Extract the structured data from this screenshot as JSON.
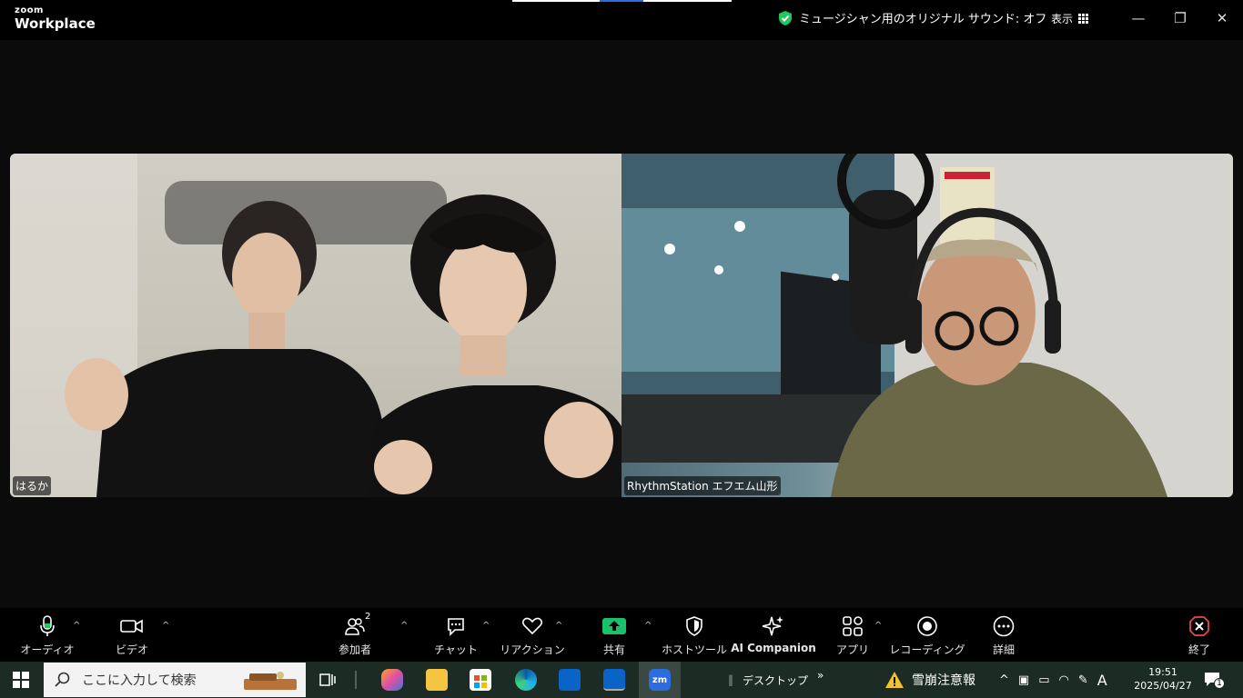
{
  "app": {
    "brand_small": "zoom",
    "brand_large": "Workplace"
  },
  "titlebar": {
    "status_text": "ミュージシャン用のオリジナル サウンド: オフ",
    "view_label": "表示",
    "minimize": "—",
    "maximize": "❐",
    "close": "✕"
  },
  "videos": [
    {
      "name": "はるか"
    },
    {
      "name": "RhythmStation エフエム山形"
    }
  ],
  "toolbar": {
    "audio": "オーディオ",
    "video": "ビデオ",
    "participants": "参加者",
    "participants_count": "2",
    "chat": "チャット",
    "reactions": "リアクション",
    "share": "共有",
    "host_tools": "ホストツール",
    "ai_companion": "AI Companion",
    "apps": "アプリ",
    "recording": "レコーディング",
    "more": "詳細",
    "end": "終了"
  },
  "taskbar": {
    "search_placeholder": "ここに入力して検索",
    "desktop_label": "デスクトップ",
    "chevrons": "»",
    "weather_alert": "雪崩注意報",
    "ime": "A",
    "time": "19:51",
    "date": "2025/04/27",
    "notification_count": "1",
    "zoom_icon_text": "zm"
  },
  "colors": {
    "accent_green": "#22c55e",
    "share_green": "#19c26a",
    "end_red": "#e5484d",
    "taskbar_bg": "#1c2b24"
  }
}
